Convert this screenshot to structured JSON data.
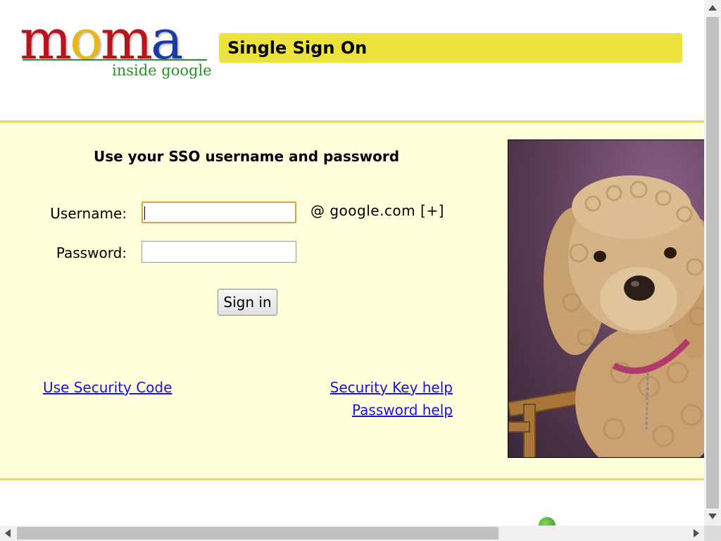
{
  "logo": {
    "letters": [
      "m",
      "o",
      "m",
      "a"
    ],
    "tagline": "inside google"
  },
  "header": {
    "title": "Single Sign On",
    "bar_color": "#ece23c"
  },
  "form": {
    "heading": "Use your SSO username and password",
    "username_label": "Username:",
    "username_value": "",
    "domain_text": "@  google.com [+]",
    "password_label": "Password:",
    "password_value": "",
    "signin_label": "Sign in"
  },
  "links": {
    "security_code": "Use Security Code",
    "security_key_help": "Security Key help",
    "password_help": "Password help"
  },
  "photo": {
    "subject": "poodle-dog-photo"
  },
  "colors": {
    "panel_background": "#ffffdc",
    "panel_border": "#f0e030",
    "link": "#1a12d8"
  },
  "icons": {
    "status_dot": "green-dot-icon"
  }
}
